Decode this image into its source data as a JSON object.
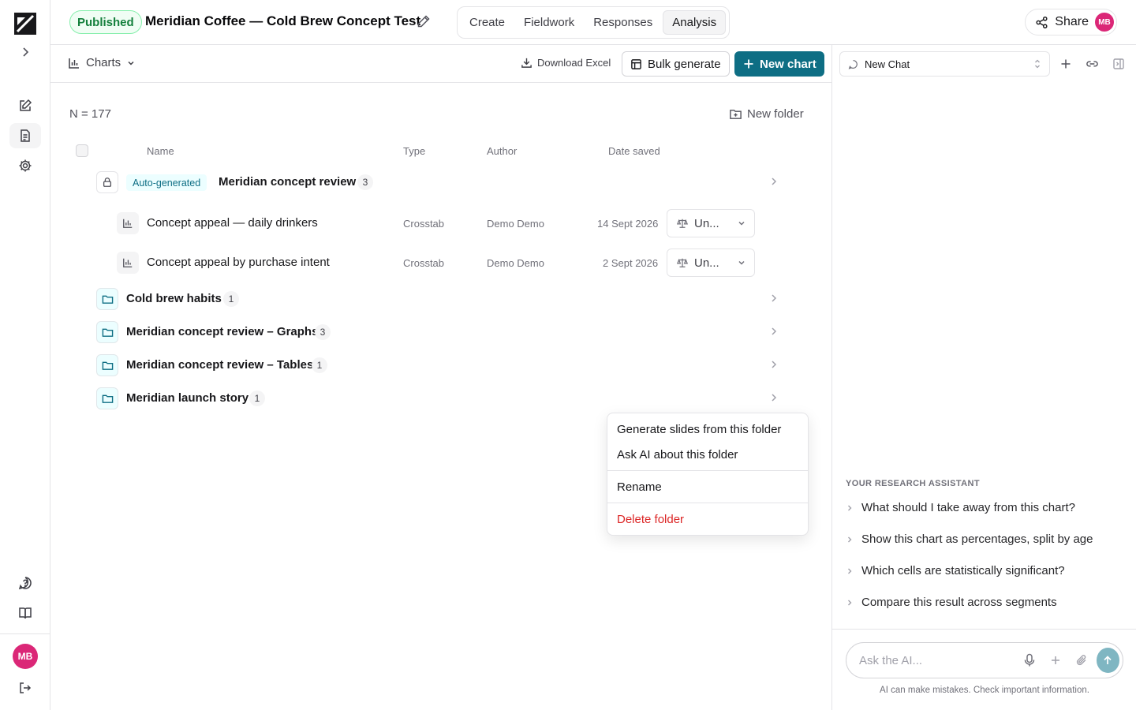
{
  "app": {
    "status_badge": "Published",
    "project_title": "Meridian Coffee — Cold Brew Concept Test",
    "tabs": [
      "Create",
      "Fieldwork",
      "Responses",
      "Analysis"
    ],
    "active_tab": "Analysis",
    "share_label": "Share",
    "user_initials": "MB"
  },
  "toolbar": {
    "view_label": "Charts",
    "download_label": "Download Excel",
    "bulk_label": "Bulk generate",
    "new_chart_label": "New chart"
  },
  "content": {
    "n_count": "N = 177",
    "new_folder_label": "New folder",
    "columns": {
      "name": "Name",
      "type": "Type",
      "author": "Author",
      "date": "Date saved"
    },
    "rows": [
      {
        "kind": "folder-auto",
        "tag": "Auto-generated",
        "name": "Meridian concept review",
        "count": "3"
      },
      {
        "kind": "chart",
        "name": "Concept appeal — daily drinkers",
        "type": "Crosstab",
        "author": "Demo Demo",
        "date": "14 Sept 2026",
        "status": "Un..."
      },
      {
        "kind": "chart",
        "name": "Concept appeal by purchase intent",
        "type": "Crosstab",
        "author": "Demo Demo",
        "date": "2 Sept 2026",
        "status": "Un..."
      },
      {
        "kind": "folder",
        "name": "Cold brew habits",
        "count": "1"
      },
      {
        "kind": "folder",
        "name": "Meridian concept review – Graphs",
        "count": "3"
      },
      {
        "kind": "folder",
        "name": "Meridian concept review – Tables",
        "count": "1"
      },
      {
        "kind": "folder",
        "name": "Meridian launch story",
        "count": "1"
      }
    ]
  },
  "context_menu": {
    "generate_slides": "Generate slides from this folder",
    "ask_ai": "Ask AI about this folder",
    "rename": "Rename",
    "delete": "Delete folder"
  },
  "chat": {
    "select_value": "New Chat",
    "assistant_title": "YOUR RESEARCH ASSISTANT",
    "suggestions": [
      "What should I take away from this chart?",
      "Show this chart as percentages, split by age",
      "Which cells are statistically significant?",
      "Compare this result across segments"
    ],
    "input_placeholder": "Ask the AI...",
    "disclaimer": "AI can make mistakes. Check important information."
  },
  "colors": {
    "accent": "#0e6e84",
    "published": "#15803d",
    "danger": "#dc2626",
    "avatar": "#db2777"
  },
  "icons": [
    "logo-icon",
    "chevron-right-icon",
    "edit-icon",
    "document-icon",
    "settings-icon",
    "help-icon",
    "book-icon",
    "logout-icon",
    "share-icon",
    "bar-chart-icon",
    "download-icon",
    "table-icon",
    "plus-icon",
    "folder-plus-icon",
    "lock-icon",
    "folder-icon",
    "scale-icon",
    "chevron-down-icon",
    "chat-icon",
    "link-icon",
    "panel-close-icon",
    "mic-icon",
    "paperclip-icon",
    "send-icon"
  ]
}
